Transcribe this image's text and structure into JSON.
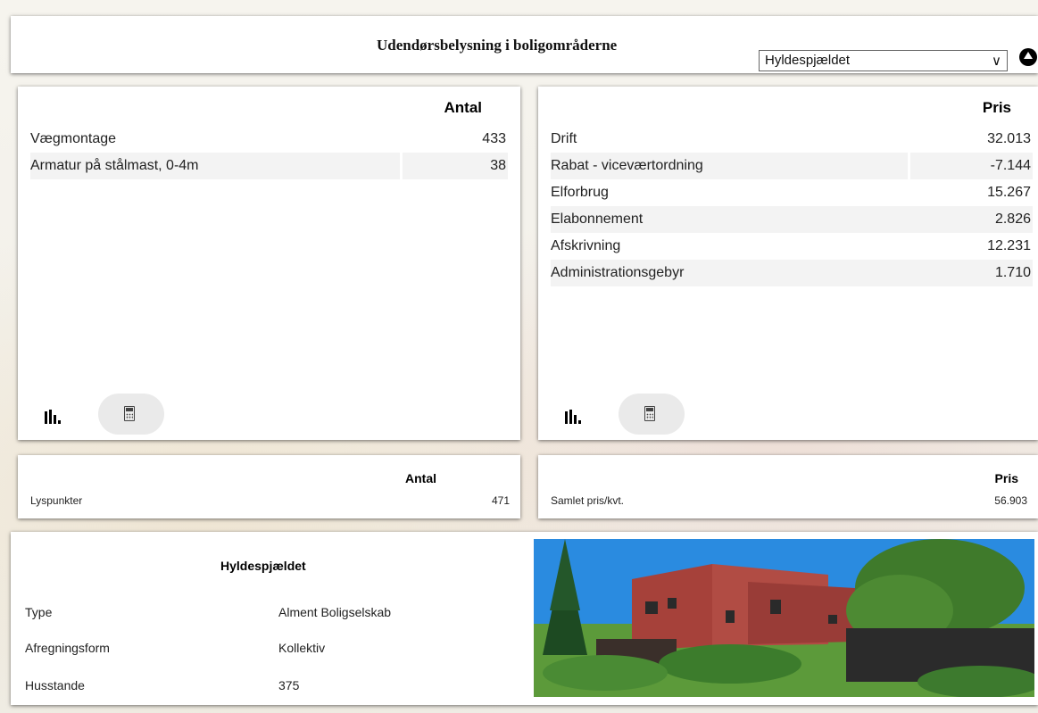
{
  "header": {
    "title": "Udendørsbelysning i boligområderne",
    "select_value": "Hyldespjældet"
  },
  "antal_table": {
    "column_header": "Antal",
    "rows": [
      {
        "label": "Vægmontage",
        "value": "433"
      },
      {
        "label": "Armatur på stålmast, 0-4m",
        "value": "38"
      }
    ]
  },
  "pris_table": {
    "column_header": "Pris",
    "rows": [
      {
        "label": "Drift",
        "value": "32.013"
      },
      {
        "label": "Rabat - viceværtordning",
        "value": "-7.144"
      },
      {
        "label": "Elforbrug",
        "value": "15.267"
      },
      {
        "label": "Elabonnement",
        "value": "2.826"
      },
      {
        "label": "Afskrivning",
        "value": "12.231"
      },
      {
        "label": "Administrationsgebyr",
        "value": "1.710"
      }
    ]
  },
  "summary_antal": {
    "header": "Antal",
    "label": "Lyspunkter",
    "value": "471"
  },
  "summary_pris": {
    "header": "Pris",
    "label": "Samlet pris/kvt.",
    "value": "56.903"
  },
  "info": {
    "name": "Hyldespjældet",
    "rows": [
      {
        "label": "Type",
        "value": "Alment Boligselskab"
      },
      {
        "label": "Afregningsform",
        "value": "Kollektiv"
      },
      {
        "label": "Husstande",
        "value": "375"
      }
    ]
  },
  "colors": {
    "panel_bg": "#ffffff",
    "row_alt_bg": "#f3f3f3",
    "text": "#222222"
  },
  "icons": [
    "bar-chart-icon",
    "calculator-icon",
    "collapse-up-icon",
    "chevron-down-icon"
  ]
}
